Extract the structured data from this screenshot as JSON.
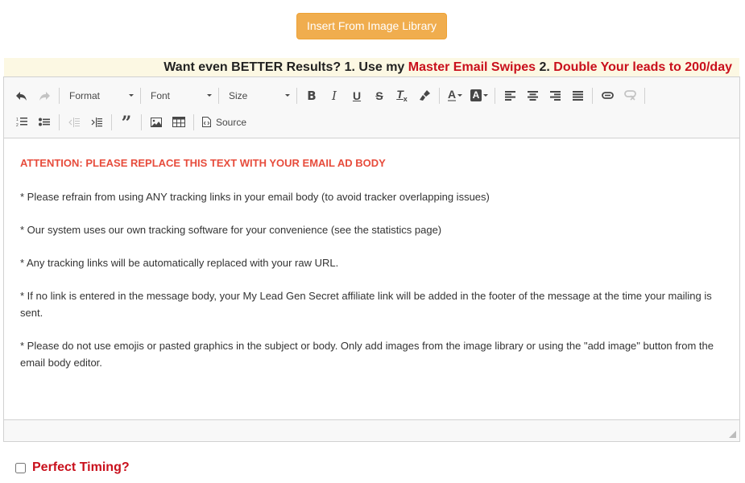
{
  "insert_button": {
    "label": "Insert From Image Library",
    "color": "#f0ad4e"
  },
  "banner": {
    "part1": "Want even BETTER Results? 1. Use my ",
    "link1": "Master Email Swipes",
    "part2": " 2. ",
    "link2": "Double Your leads to 200/day",
    "background": "#fcf8e3",
    "accent": "#c9101c"
  },
  "toolbar": {
    "row1": {
      "undo": "undo-icon",
      "redo": "redo-icon",
      "format_label": "Format",
      "font_label": "Font",
      "size_label": "Size",
      "bold": "bold-icon",
      "italic": "italic-icon",
      "underline": "underline-icon",
      "strike": "strikethrough-icon",
      "remove_format": "remove-format-icon",
      "copy_format": "paintbrush-icon",
      "text_color": "text-color-icon",
      "bg_color": "background-color-icon",
      "align_left": "align-left-icon",
      "align_center": "align-center-icon",
      "align_right": "align-right-icon",
      "justify": "justify-icon",
      "link": "link-icon",
      "unlink": "unlink-icon"
    },
    "row2": {
      "numbered_list": "numbered-list-icon",
      "bulleted_list": "bulleted-list-icon",
      "outdent": "outdent-icon",
      "indent": "indent-icon",
      "blockquote": "blockquote-icon",
      "image": "image-icon",
      "table": "table-icon",
      "source_label": "Source"
    }
  },
  "content": {
    "attention": "ATTENTION: PLEASE REPLACE THIS TEXT WITH YOUR EMAIL AD BODY",
    "paragraphs": [
      "* Please refrain from using ANY tracking links in your email body (to avoid tracker overlapping issues)",
      "* Our system uses our own tracking software for your convenience (see the statistics page)",
      "* Any tracking links will be automatically replaced with your raw URL.",
      "* If no link is entered in the message body, your My Lead Gen Secret affiliate link will be added in the footer of the message at the time your mailing is sent.",
      "* Please do not use emojis or pasted graphics in the subject or body. Only add images from the image library or using the \"add image\" button from the email body editor."
    ]
  },
  "perfect_timing": {
    "label": "Perfect Timing?",
    "checked": false
  }
}
